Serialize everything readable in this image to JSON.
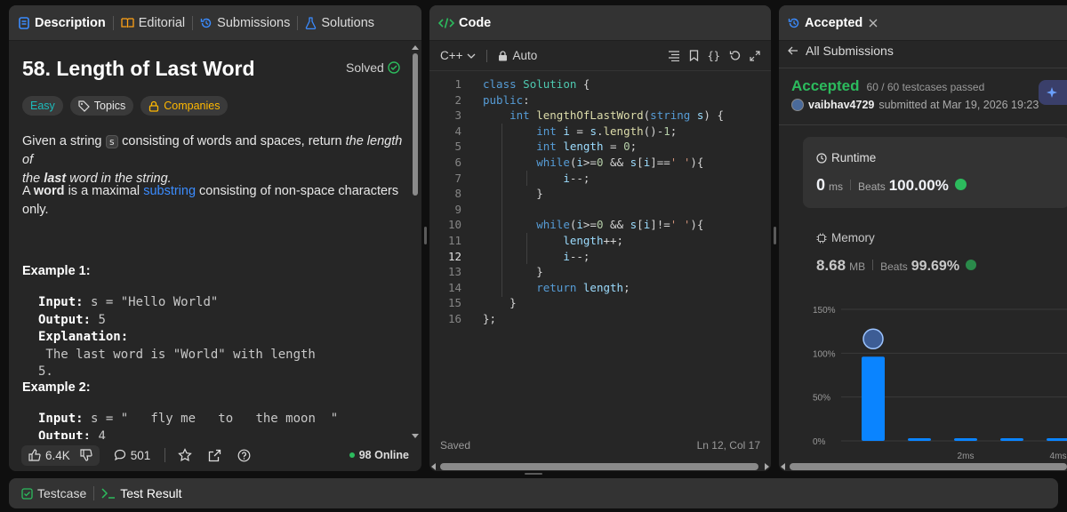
{
  "description_panel": {
    "tabs": [
      "Description",
      "Editorial",
      "Submissions",
      "Solutions"
    ],
    "title": "58. Length of Last Word",
    "status": "Solved",
    "pills": [
      "Easy",
      "Topics",
      "Companies"
    ],
    "statement_p1_a": "Given a string ",
    "statement_p1_code": "s",
    "statement_p1_b": " consisting of words and spaces, return ",
    "statement_p1_em": "the length of",
    "statement_p1_em2a": "the ",
    "statement_p1_em2b": "last",
    "statement_p1_em2c": " word in the string.",
    "statement_p2_a": "A ",
    "statement_p2_b": "word",
    "statement_p2_c": " is a maximal ",
    "statement_p2_link": "substring",
    "statement_p2_d": " consisting of non-space characters",
    "statement_p2_e": "only.",
    "example1_title": "Example 1:",
    "example1_input_label": "Input:",
    "example1_input": " s = \"Hello World\"",
    "example1_output_label": "Output:",
    "example1_output": " 5",
    "example1_expl_label": "Explanation:",
    "example1_expl": " The last word is \"World\" with length",
    "example1_expl2": "5.",
    "example2_title": "Example 2:",
    "example2_input_label": "Input:",
    "example2_input": " s = \"   fly me   to   the moon  \"",
    "example2_output_label": "Output:",
    "example2_output": " 4",
    "likes": "6.4K",
    "comments": "501",
    "online": "98 Online"
  },
  "code_panel": {
    "tab": "Code",
    "language": "C++",
    "mode": "Auto",
    "status": "Saved",
    "cursor": "Ln 12, Col 17",
    "current_line": 12,
    "lines": [
      "class Solution {",
      "public:",
      "    int lengthOfLastWord(string s) {",
      "        int i = s.length()-1;",
      "        int length = 0;",
      "        while(i>=0 && s[i]==' '){",
      "            i--;",
      "        }",
      "",
      "        while(i>=0 && s[i]!=' '){",
      "            length++;",
      "            i--;",
      "        }",
      "        return length;",
      "    }",
      "};"
    ]
  },
  "result_panel": {
    "tab": "Accepted",
    "back_label": "All Submissions",
    "verdict": "Accepted",
    "testcases": "60 / 60 testcases passed",
    "user": "vaibhav4729",
    "submitted": "submitted at Mar 19, 2026 19:23",
    "runtime_label": "Runtime",
    "runtime_value": "0",
    "runtime_unit": "ms",
    "runtime_beats_label": "Beats",
    "runtime_beats": "100.00%",
    "memory_label": "Memory",
    "memory_value": "8.68",
    "memory_unit": "MB",
    "memory_beats_label": "Beats",
    "memory_beats": "99.69%"
  },
  "chart_data": {
    "type": "bar",
    "y_ticks": [
      "150%",
      "100%",
      "50%",
      "0%"
    ],
    "ylim": [
      0,
      150
    ],
    "x_ticks": [
      "2ms",
      "4ms"
    ],
    "categories": [
      "0ms",
      "1ms",
      "2ms",
      "3ms",
      "4ms"
    ],
    "values": [
      96,
      2,
      2,
      2,
      2
    ]
  },
  "bottom_bar": {
    "testcase": "Testcase",
    "result": "Test Result"
  },
  "colors": {
    "accent_green": "#2cbb5d",
    "easy": "#1cbaba",
    "link": "#3b8cff",
    "bar": "#0a84ff",
    "companies": "#ffb800"
  }
}
